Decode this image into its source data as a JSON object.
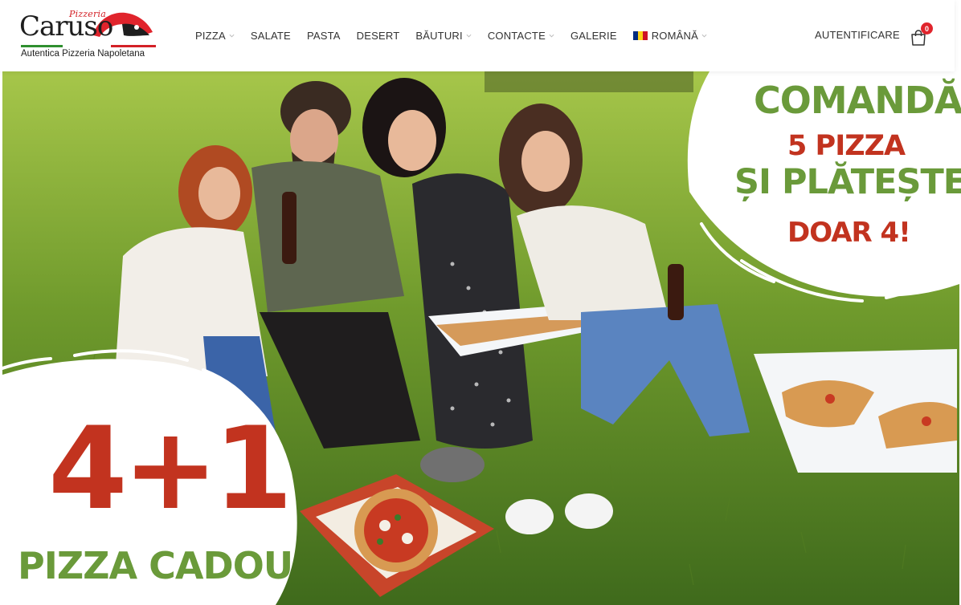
{
  "logo": {
    "small_text": "Pizzeria",
    "name": "Caruso",
    "tagline": "Autentica Pizzeria Napoletana"
  },
  "nav": {
    "items": [
      {
        "label": "PIZZA",
        "has_dropdown": true
      },
      {
        "label": "SALATE",
        "has_dropdown": false
      },
      {
        "label": "PASTA",
        "has_dropdown": false
      },
      {
        "label": "DESERT",
        "has_dropdown": false
      },
      {
        "label": "BĂUTURI",
        "has_dropdown": true
      },
      {
        "label": "CONTACTE",
        "has_dropdown": true
      },
      {
        "label": "GALERIE",
        "has_dropdown": false
      }
    ],
    "language": {
      "label": "ROMÂNĂ",
      "flag_colors": [
        "#002b7f",
        "#fcd116",
        "#ce1126"
      ]
    }
  },
  "account": {
    "login_label": "AUTENTIFICARE"
  },
  "cart": {
    "count": "0",
    "icon": "shopping-bag-icon"
  },
  "promo_top": {
    "line1": "COMANDĂ",
    "line2": "5 PIZZA",
    "line3": "ȘI PLĂTEȘTE",
    "line4": "DOAR 4!"
  },
  "promo_bottom": {
    "headline": "4+1",
    "line2": "PIZZA CADOU"
  },
  "colors": {
    "brand_red": "#c2331f",
    "brand_green": "#6a9a3a",
    "badge_red": "#e0242c",
    "nav_text": "#333333"
  }
}
